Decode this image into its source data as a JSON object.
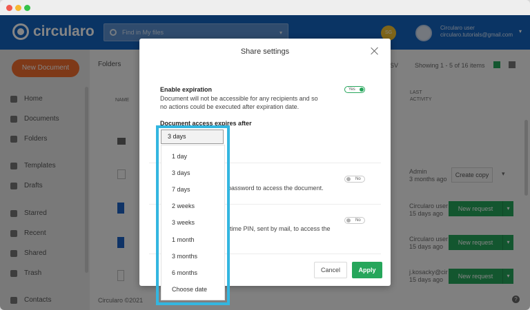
{
  "header": {
    "logo_text": "circularo",
    "search_placeholder": "Find in My files",
    "avatar_initials": "SG",
    "user_name": "Circularo user",
    "user_email": "circularo.tutorials@gmail.com"
  },
  "sidebar": {
    "new_document": "New Document",
    "items": [
      {
        "label": "Home"
      },
      {
        "label": "Documents"
      },
      {
        "label": "Folders"
      },
      {
        "label": "Templates"
      },
      {
        "label": "Drafts"
      },
      {
        "label": "Starred"
      },
      {
        "label": "Recent"
      },
      {
        "label": "Shared"
      },
      {
        "label": "Trash"
      },
      {
        "label": "Contacts"
      }
    ]
  },
  "main": {
    "folders_dropdown": "Folders",
    "csv": "SV",
    "showing": "Showing 1 - 5 of 16 items",
    "col_name": "NAME",
    "col_last_activity": "LAST ACTIVITY",
    "footer": "Circularo ©2021",
    "rows": [
      {
        "activity_user": "Admin",
        "activity_time": "3 months ago",
        "action": "Create copy"
      },
      {
        "activity_user": "Circularo user",
        "activity_time": "15 days ago",
        "action": "New request"
      },
      {
        "activity_user": "Circularo user",
        "activity_time": "15 days ago",
        "action": "New request"
      },
      {
        "activity_user": "j.kosacky@cir",
        "activity_time": "15 days ago",
        "action": "New request"
      }
    ]
  },
  "modal": {
    "title": "Share settings",
    "expiration": {
      "label": "Enable expiration",
      "description": "Document will not be accessible for any recipients and so no actions could be executed after expiration date.",
      "toggle": "Yes",
      "expires_after_label": "Document access expires after"
    },
    "password": {
      "fragment": "password to access the document.",
      "toggle": "No"
    },
    "pin": {
      "fragment_1": "-time PIN, sent by mail, to access the",
      "toggle": "No"
    },
    "cancel": "Cancel",
    "apply": "Apply"
  },
  "expiry_select": {
    "selected": "3 days",
    "options": [
      "1 day",
      "3 days",
      "7 days",
      "2 weeks",
      "3 weeks",
      "1 month",
      "3 months",
      "6 months",
      "Choose date"
    ]
  },
  "colors": {
    "brand_blue": "#1565c0",
    "accent_orange": "#f26d2f",
    "success_green": "#26a65b",
    "highlight_cyan": "#33b6e0"
  }
}
